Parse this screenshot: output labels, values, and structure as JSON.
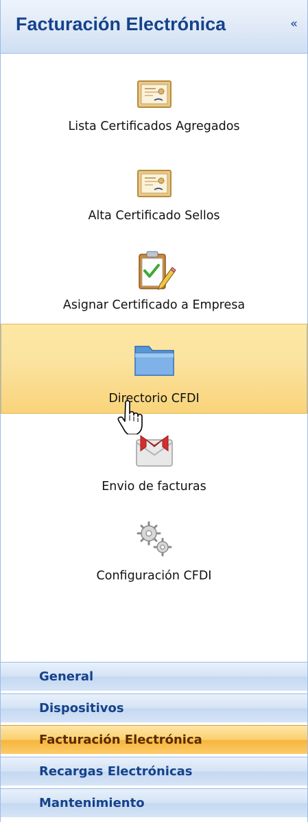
{
  "header": {
    "title": "Facturación Electrónica",
    "collapse_glyph": "«"
  },
  "items": [
    {
      "label": "Lista Certificados Agregados",
      "icon": "certificate-icon"
    },
    {
      "label": "Alta Certificado Sellos",
      "icon": "certificate-icon"
    },
    {
      "label": "Asignar Certificado a Empresa",
      "icon": "clipboard-pencil-icon"
    },
    {
      "label": "Directorio CFDI",
      "icon": "folder-icon",
      "active": true
    },
    {
      "label": "Envio de facturas",
      "icon": "gmail-envelope-icon"
    },
    {
      "label": "Configuración CFDI",
      "icon": "gears-icon"
    }
  ],
  "nav": [
    {
      "label": "General"
    },
    {
      "label": "Dispositivos"
    },
    {
      "label": "Facturación Electrónica",
      "active": true
    },
    {
      "label": "Recargas Electrónicas"
    },
    {
      "label": "Mantenimiento"
    }
  ],
  "colors": {
    "header_text": "#15428b",
    "active_item_bg": "#fbe3a0",
    "active_nav_bg": "#f7b43b",
    "border": "#99bbe8"
  }
}
